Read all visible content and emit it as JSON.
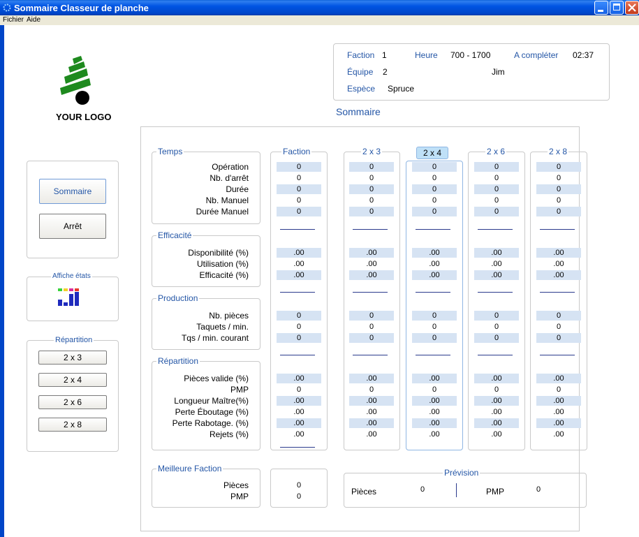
{
  "window": {
    "title": "Sommaire Classeur de planche"
  },
  "menu": {
    "items": [
      "Fichier",
      "Aide"
    ]
  },
  "logo": {
    "text": "YOUR LOGO"
  },
  "header": {
    "faction_label": "Faction",
    "faction_value": "1",
    "heure_label": "Heure",
    "heure_value": "700 - 1700",
    "acompleter_label": "A compléter",
    "acompleter_value": "02:37",
    "equipe_label": "Équipe",
    "equipe_value": "2",
    "equipe_person": "Jim",
    "espece_label": "Espèce",
    "espece_value": "Spruce"
  },
  "sommaire_title": "Sommaire",
  "side": {
    "sommaire_btn": "Sommaire",
    "arret_btn": "Arrêt",
    "affiche_etats": "Affiche états",
    "repartition": "Répartition",
    "rep_buttons": [
      "2 x 3",
      "2 x 4",
      "2 x 6",
      "2 x 8"
    ]
  },
  "sections": {
    "temps": "Temps",
    "efficacite": "Efficacité",
    "production": "Production",
    "repartition": "Répartition",
    "meilleure": "Meilleure Faction"
  },
  "rows": {
    "temps": [
      "Opération",
      "Nb. d'arrêt",
      "Durée",
      "Nb. Manuel",
      "Durée Manuel"
    ],
    "efficacite": [
      "Disponibilité (%)",
      "Utilisation (%)",
      "Efficacité (%)"
    ],
    "production": [
      "Nb. pièces",
      "Taquets / min.",
      "Tqs / min. courant"
    ],
    "repartition": [
      "Pièces valide (%)",
      "PMP",
      "Longueur Maître(%)",
      "Perte Éboutage (%)",
      "Perte Rabotage. (%)",
      "Rejets (%)"
    ],
    "meilleure": [
      "Pièces",
      "PMP"
    ]
  },
  "columns": {
    "faction": "Faction",
    "c2x3": "2 x 3",
    "c2x4": "2 x 4",
    "c2x6": "2 x 6",
    "c2x8": "2 x 8"
  },
  "values": {
    "temps": [
      "0",
      "0",
      "0",
      "0",
      "0"
    ],
    "efficacite": [
      ".00",
      ".00",
      ".00"
    ],
    "production": [
      "0",
      "0",
      "0"
    ],
    "repartition": [
      ".00",
      "0",
      ".00",
      ".00",
      ".00",
      ".00"
    ],
    "meilleure": [
      "0",
      "0"
    ]
  },
  "prevision": {
    "title": "Prévision",
    "pieces_label": "Pièces",
    "pieces_value": "0",
    "pmp_label": "PMP",
    "pmp_value": "0"
  },
  "colors": {
    "titlebar": "#0054e3",
    "accent": "#2456a6",
    "cellshade": "#d6e3f3",
    "tab_active": "#bfe0f7"
  }
}
